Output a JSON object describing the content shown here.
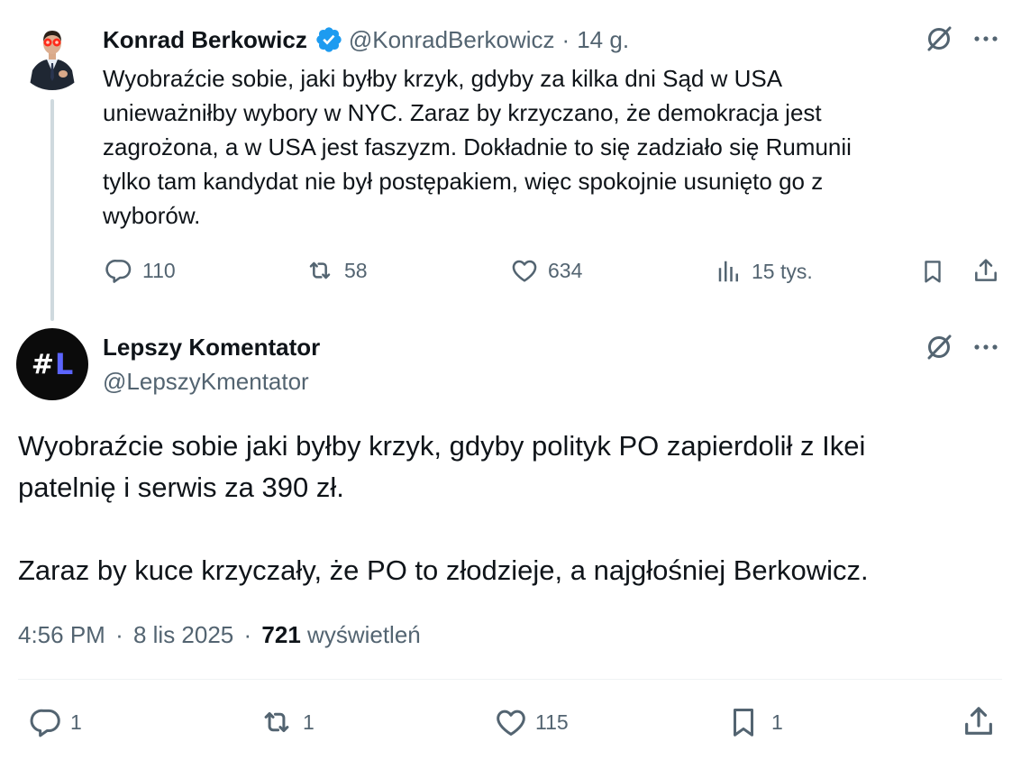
{
  "parent_tweet": {
    "author_name": "Konrad Berkowicz",
    "handle": "@KonradBerkowicz",
    "separator": "·",
    "time_ago": "14 g.",
    "text_lines": [
      "Wyobraźcie sobie, jaki byłby krzyk, gdyby za kilka dni Sąd w USA",
      "unieważniłby wybory w NYC. Zaraz by krzyczano, że demokracja jest",
      "zagrożona, a w USA jest faszyzm. Dokładnie to się zadziało się Rumunii",
      "tylko tam kandydat nie był postępakiem, więc spokojnie usunięto go z",
      "wyborów."
    ],
    "stats": {
      "replies": "110",
      "reposts": "58",
      "likes": "634",
      "views": "15 tys."
    }
  },
  "main_tweet": {
    "author_name": "Lepszy Komentator",
    "handle": "@LepszyKmentator",
    "avatar_text_hash": "#",
    "avatar_text_letter": "L",
    "paragraph1_lines": [
      "Wyobraźcie sobie jaki byłby krzyk, gdyby polityk PO zapierdolił z Ikei",
      "patelnię i serwis za 390 zł."
    ],
    "paragraph2": "Zaraz by kuce krzyczały, że PO to złodzieje, a najgłośniej Berkowicz.",
    "time": "4:56 PM",
    "separator": "·",
    "date": "8 lis 2025",
    "views_count": "721",
    "views_label": "wyświetleń",
    "stats": {
      "replies": "1",
      "reposts": "1",
      "likes": "115",
      "bookmarks": "1"
    }
  },
  "colors": {
    "text": "#0f1419",
    "muted": "#536471",
    "verified": "#1d9bf0",
    "thread_line": "#cfd9de",
    "divider": "#eff3f4",
    "avatar2_bg": "#0b0b0b",
    "avatar2_letter": "#5b64ff"
  },
  "icons": {
    "verified": "verified-badge-icon",
    "grok": "grok-icon",
    "more": "more-dots-icon",
    "reply": "reply-icon",
    "repost": "repost-icon",
    "like": "like-icon",
    "views": "views-icon",
    "bookmark": "bookmark-icon",
    "share": "share-icon"
  }
}
